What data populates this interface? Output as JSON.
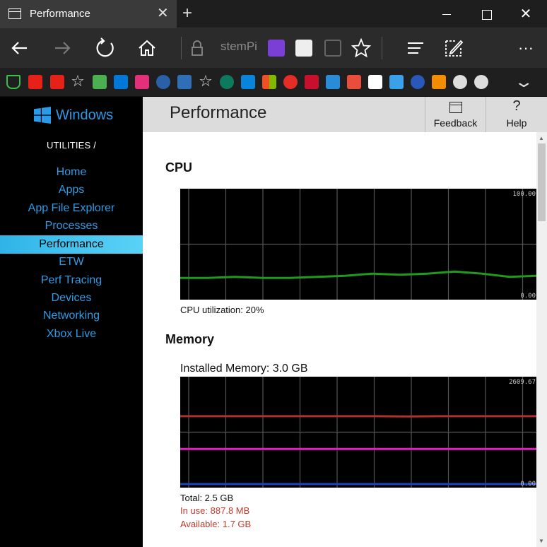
{
  "browser": {
    "tab_title": "Performance",
    "address_fragment": "stemPi",
    "icons": {
      "tab": "page-icon",
      "tab_close": "close-icon",
      "new_tab": "plus-icon",
      "back": "back-arrow-icon",
      "forward": "forward-arrow-icon",
      "refresh": "refresh-icon",
      "home": "home-icon",
      "lock": "lock-icon",
      "favorite": "star-icon",
      "hub": "hub-icon",
      "notes": "web-note-icon",
      "more": "more-icon"
    },
    "favorites_chevron": "chevron-down-icon"
  },
  "sidebar": {
    "logo_text": "Windows",
    "section_label": "UTILITIES /",
    "items": [
      {
        "label": "Home"
      },
      {
        "label": "Apps"
      },
      {
        "label": "App File Explorer"
      },
      {
        "label": "Processes"
      },
      {
        "label": "Performance"
      },
      {
        "label": "ETW"
      },
      {
        "label": "Perf Tracing"
      },
      {
        "label": "Devices"
      },
      {
        "label": "Networking"
      },
      {
        "label": "Xbox Live"
      }
    ],
    "active_index": 4
  },
  "header": {
    "title": "Performance",
    "feedback_label": "Feedback",
    "help_label": "Help",
    "feedback_icon": "calendar-icon",
    "help_icon": "question-icon"
  },
  "cpu": {
    "title": "CPU",
    "utilization_text": "CPU utilization: 20%",
    "y_max_label": "100.00",
    "y_min_label": "0.00",
    "chart_data": {
      "type": "line",
      "ylim": [
        0,
        100
      ],
      "series": [
        {
          "color": "#1f9a1f",
          "values": [
            18,
            18,
            19,
            18,
            18,
            19,
            20,
            22,
            21,
            22,
            24,
            22,
            19,
            20
          ]
        }
      ]
    }
  },
  "memory": {
    "title": "Memory",
    "installed_text": "Installed Memory: 3.0 GB",
    "y_max_label": "2609.67",
    "y_min_label": "0.00",
    "total_text": "Total: 2.5 GB",
    "in_use_text": "In use: 887.8 MB",
    "available_text": "Available: 1.7 GB",
    "chart_data": {
      "type": "line",
      "ylim": [
        0,
        2609.67
      ],
      "series": [
        {
          "color": "#b03030",
          "values": [
            1700,
            1700,
            1700,
            1700,
            1700,
            1700,
            1700,
            1695,
            1700,
            1700,
            1700,
            1700
          ]
        },
        {
          "color": "#e020c0",
          "values": [
            888,
            888,
            888,
            888,
            888,
            888,
            888,
            888,
            888,
            888,
            888,
            888
          ]
        },
        {
          "color": "#2040c0",
          "values": [
            20,
            20,
            20,
            20,
            20,
            20,
            20,
            20,
            20,
            20,
            20,
            20
          ]
        }
      ]
    }
  }
}
